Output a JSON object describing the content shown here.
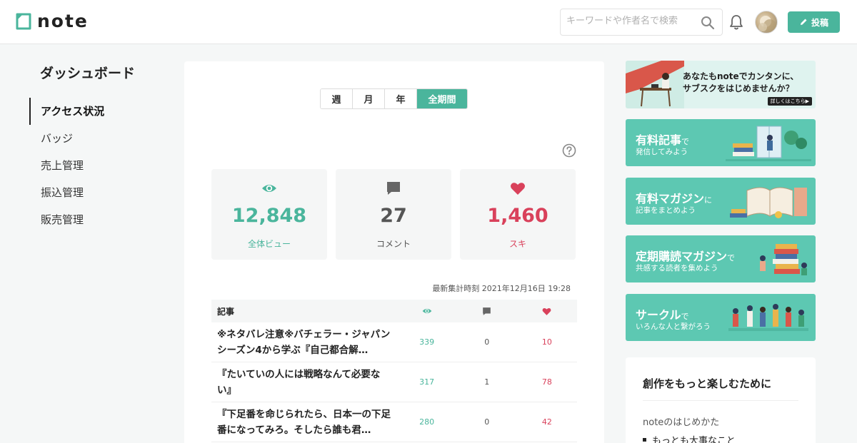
{
  "header": {
    "logo_text": "note",
    "search_placeholder": "キーワードや作者名で検索",
    "post_label": "投稿"
  },
  "sidebar": {
    "title": "ダッシュボード",
    "items": [
      {
        "label": "アクセス状況",
        "active": true
      },
      {
        "label": "バッジ"
      },
      {
        "label": "売上管理"
      },
      {
        "label": "振込管理"
      },
      {
        "label": "販売管理"
      }
    ]
  },
  "main": {
    "periods": [
      "週",
      "月",
      "年",
      "全期間"
    ],
    "selected_period": "全期間",
    "stats": {
      "views": {
        "value": "12,848",
        "label": "全体ビュー"
      },
      "comments": {
        "value": "27",
        "label": "コメント"
      },
      "likes": {
        "value": "1,460",
        "label": "スキ"
      }
    },
    "updated": "最新集計時刻 2021年12月16日 19:28",
    "table": {
      "header_title": "記事",
      "rows": [
        {
          "title": "※ネタバレ注意※バチェラー・ジャパン シーズン4から学ぶ『自己都合解…",
          "views": "339",
          "comments": "0",
          "likes": "10"
        },
        {
          "title": "『たいていの人には戦略なんて必要ない』",
          "views": "317",
          "comments": "1",
          "likes": "78"
        },
        {
          "title": "『下足番を命じられたら、日本一の下足番になってみろ。そしたら誰も君…",
          "views": "280",
          "comments": "0",
          "likes": "42"
        }
      ]
    }
  },
  "right": {
    "top_banner": {
      "line1": "あなたもnoteでカンタンに、",
      "line2": "サブスクをはじめませんか？",
      "badge": "詳しくはこちら▶"
    },
    "promos": [
      {
        "title": "有料記事",
        "suffix": "で",
        "sub": "発信してみよう"
      },
      {
        "title": "有料マガジン",
        "suffix": "に",
        "sub": "記事をまとめよう"
      },
      {
        "title": "定期購読マガジン",
        "suffix": "で",
        "sub": "共感する読者を集めよう"
      },
      {
        "title": "サークル",
        "suffix": "で",
        "sub": "いろんな人と繋がろう"
      }
    ],
    "card": {
      "title": "創作をもっと楽しむために",
      "subtitle": "noteのはじめかた",
      "item": "もっとも大事なこと"
    }
  },
  "colors": {
    "accent": "#4ab59c",
    "like": "#d9415b",
    "promo": "#5dc8b2"
  }
}
